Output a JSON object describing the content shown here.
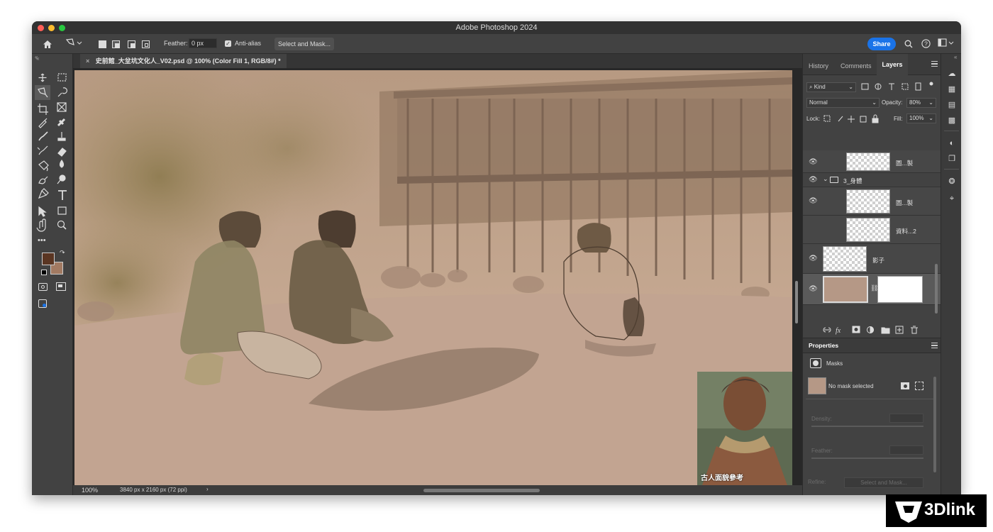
{
  "app": {
    "window_title": "Adobe Photoshop 2024"
  },
  "options_bar": {
    "feather_label": "Feather:",
    "feather_value": "0 px",
    "anti_alias_label": "Anti-alias",
    "anti_alias_checked": true,
    "select_mask_label": "Select and Mask...",
    "share_label": "Share"
  },
  "document": {
    "tab_title": "史前館_大坌坑文化人_V02.psd @ 100% (Color Fill 1, RGB/8#) *",
    "zoom": "100%",
    "info": "3840 px x 2160 px (72 ppi)",
    "reference_caption": "古人面貌參考"
  },
  "colors": {
    "foreground": "#5a3522",
    "background": "#a27a62",
    "accent": "#1a73e8",
    "canvas_tone": "#bfa18f"
  },
  "panel_tabs": {
    "history": "History",
    "comments": "Comments",
    "layers": "Layers"
  },
  "layers_panel": {
    "filter_kind": "Kind",
    "blend_mode": "Normal",
    "opacity_label": "Opacity:",
    "opacity_value": "80%",
    "lock_label": "Lock:",
    "fill_label": "Fill:",
    "fill_value": "100%",
    "layers": [
      {
        "name": "圖...製",
        "visible": true
      },
      {
        "name": "3_身體",
        "visible": true,
        "group": true
      },
      {
        "name": "圖...製",
        "visible": true
      },
      {
        "name": "資料...2",
        "visible": false
      },
      {
        "name": "影子",
        "visible": true
      },
      {
        "name": "",
        "visible": true,
        "fill_layer": true
      }
    ]
  },
  "properties_panel": {
    "title": "Properties",
    "section": "Masks",
    "mask_status": "No mask selected",
    "density_label": "Density:",
    "feather_label": "Feather:",
    "refine_label": "Refine:",
    "select_mask_label": "Select and Mask..."
  },
  "watermark": {
    "text": "3Dlink"
  }
}
